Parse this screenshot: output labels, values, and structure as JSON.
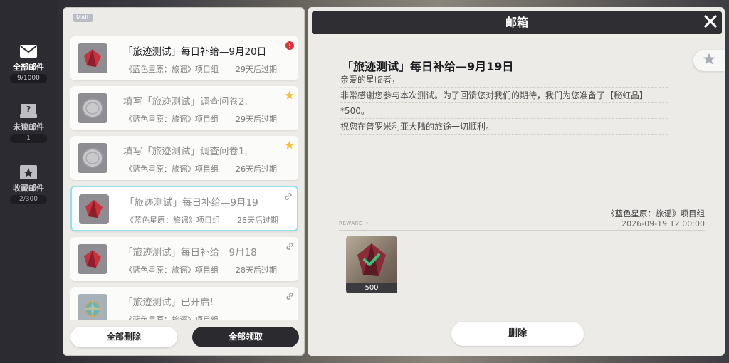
{
  "nav": {
    "items": [
      {
        "label": "全部邮件",
        "count": "9/1000",
        "icon": "envelope-icon",
        "active": true
      },
      {
        "label": "未读邮件",
        "count": "1",
        "icon": "unread-mail-icon",
        "active": false
      },
      {
        "label": "收藏邮件",
        "count": "2/300",
        "icon": "star-mail-icon",
        "active": false
      }
    ]
  },
  "list": {
    "header_badge": "MAIL",
    "mails": [
      {
        "title": "「旅迹测试」每日补给—9月20日",
        "sender": "《蓝色星原：旅谣》项目组",
        "expire": "29天后过期",
        "thumb": "red-crystal-icon",
        "flag": "alert-icon",
        "state": "unread"
      },
      {
        "title": "填写「旅迹测试」调查问卷2,",
        "sender": "《蓝色星原：旅谣》项目组",
        "expire": "29天后过期",
        "thumb": "silver-coin-icon",
        "flag": "star-icon",
        "state": "read"
      },
      {
        "title": "填写「旅迹测试」调查问卷1,",
        "sender": "《蓝色星原：旅谣》项目组",
        "expire": "26天后过期",
        "thumb": "silver-coin-icon",
        "flag": "star-icon",
        "state": "read"
      },
      {
        "title": "「旅迹测试」每日补给—9月19",
        "sender": "《蓝色星原：旅谣》项目组",
        "expire": "28天后过期",
        "thumb": "red-crystal-icon",
        "flag": "link-icon",
        "state": "selected"
      },
      {
        "title": "「旅迹测试」每日补给—9月18",
        "sender": "《蓝色星原：旅谣》项目组",
        "expire": "28天后过期",
        "thumb": "red-crystal-icon",
        "flag": "link-icon",
        "state": "read"
      },
      {
        "title": "「旅迹测试」已开启!",
        "sender": "《蓝色星原：旅谣》项目组",
        "expire": "",
        "thumb": "compass-gem-icon",
        "flag": "link-icon",
        "state": "read"
      }
    ],
    "delete_all_label": "全部删除",
    "claim_all_label": "全部领取"
  },
  "detail": {
    "window_title": "邮箱",
    "heading": "「旅迹测试」每日补给—9月19日",
    "body_lines": [
      "亲爱的星临者，",
      "非常感谢您参与本次测试。为了回馈您对我们的期待，我们为您准备了【秘虹晶】",
      "*500。",
      "祝您在普罗米利亚大陆的旅途一切顺利。"
    ],
    "signature": "《蓝色星原：旅谣》项目组",
    "date": "2026-09-19 12:00:00",
    "reward_label": "REWARD ✦",
    "reward": {
      "name": "秘虹晶",
      "quantity": "500",
      "claimed": true
    },
    "delete_label": "删除"
  },
  "colors": {
    "accent_selected": "#8fe3e8",
    "alert": "#d9373a",
    "star": "#f2c230",
    "check": "#35c77a",
    "dark_button": "#2b2b2f"
  }
}
